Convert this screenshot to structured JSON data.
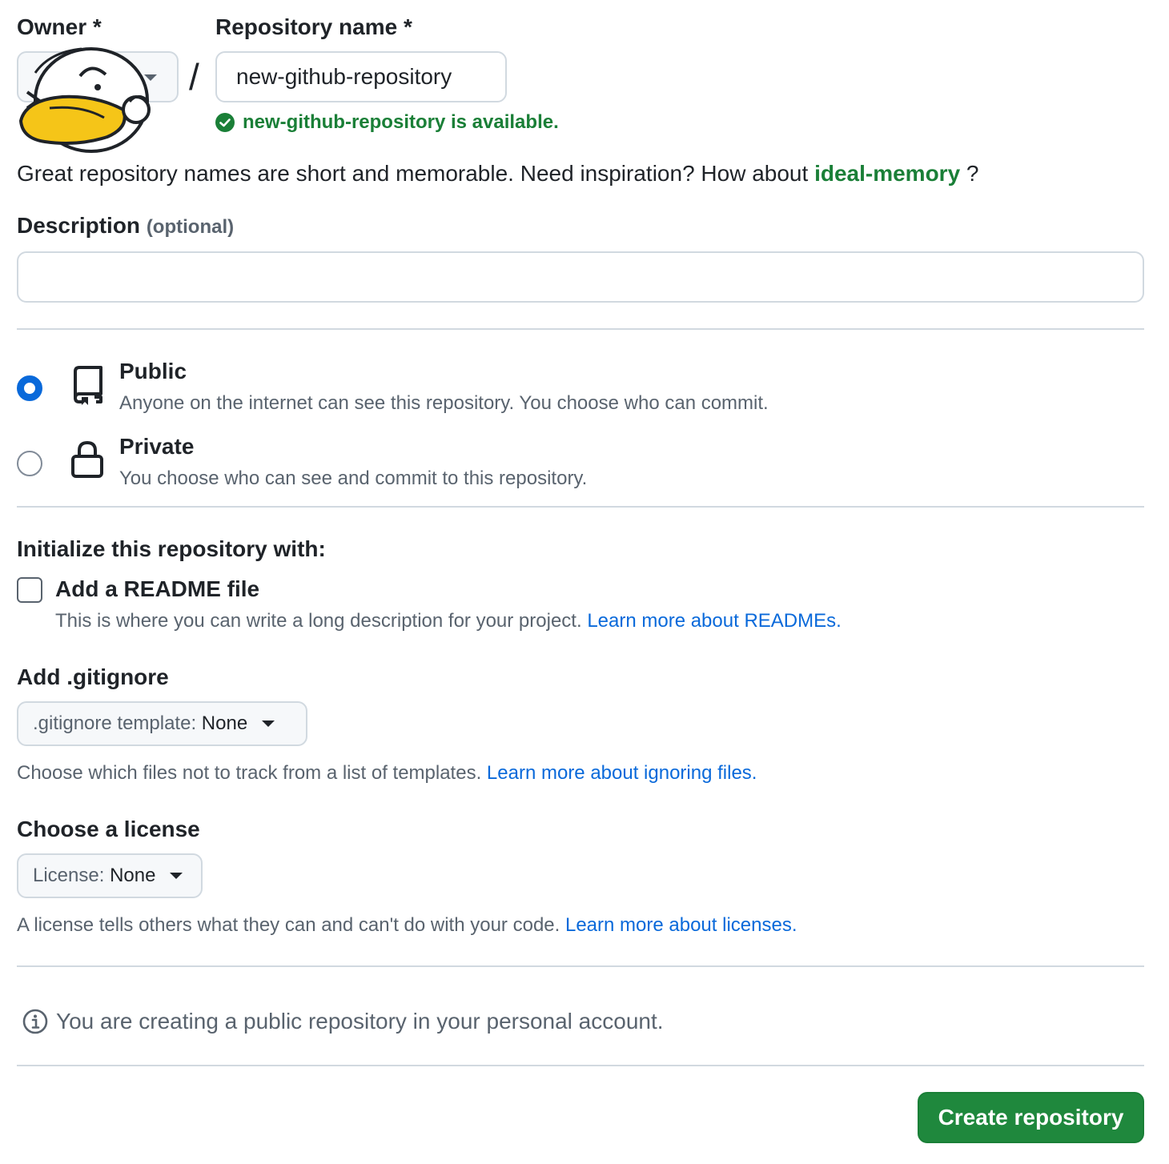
{
  "owner": {
    "label": "Owner",
    "required_mark": "*"
  },
  "repo": {
    "label": "Repository name",
    "required_mark": "*",
    "value": "new-github-repository",
    "separator": "/",
    "availability": "new-github-repository is available."
  },
  "inspiration": {
    "prefix": "Great repository names are short and memorable. Need inspiration? How about ",
    "suggestion": "ideal-memory",
    "suffix": " ?"
  },
  "description": {
    "label": "Description",
    "optional": "(optional)",
    "value": ""
  },
  "visibility": {
    "options": [
      {
        "title": "Public",
        "desc": "Anyone on the internet can see this repository. You choose who can commit.",
        "selected": true,
        "icon": "repo-icon"
      },
      {
        "title": "Private",
        "desc": "You choose who can see and commit to this repository.",
        "selected": false,
        "icon": "lock-icon"
      }
    ]
  },
  "initialize": {
    "heading": "Initialize this repository with:",
    "readme_label": "Add a README file",
    "readme_checked": false,
    "readme_desc": "This is where you can write a long description for your project.",
    "readme_link": "Learn more about READMEs."
  },
  "gitignore": {
    "heading": "Add .gitignore",
    "select_prefix": ".gitignore template:",
    "select_value": "None",
    "desc": "Choose which files not to track from a list of templates.",
    "link": "Learn more about ignoring files."
  },
  "license": {
    "heading": "Choose a license",
    "select_prefix": "License:",
    "select_value": "None",
    "desc": "A license tells others what they can and can't do with your code.",
    "link": "Learn more about licenses."
  },
  "info": {
    "text": "You are creating a public repository in your personal account.",
    "icon": "info-icon"
  },
  "actions": {
    "create_label": "Create repository"
  },
  "colors": {
    "primary_button": "#1f883d",
    "success_text": "#1a7f37",
    "link": "#0969da",
    "radio_selected": "#0969da",
    "border": "#d1d9e0"
  }
}
